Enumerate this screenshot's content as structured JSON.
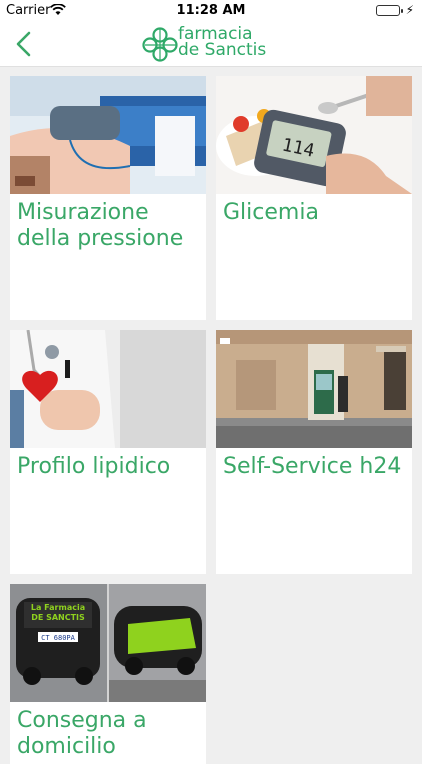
{
  "status_bar": {
    "carrier": "Carrier",
    "time": "11:28 AM"
  },
  "header": {
    "logo_line1": "farmacia",
    "logo_line2": "de Sanctis"
  },
  "services": [
    {
      "title": "Misurazione della pressione"
    },
    {
      "title": "Glicemia"
    },
    {
      "title": "Profilo lipidico"
    },
    {
      "title": "Self-Service h24"
    },
    {
      "title": "Consegna a domicilio"
    }
  ],
  "photo_labels": {
    "glucometer_reading": "114",
    "car_banner_line1": "La Farmacia",
    "car_banner_line2": "DE SANCTIS",
    "car_plate": "CT 680PA"
  },
  "colors": {
    "brand_green": "#3aa767",
    "background": "#efefef"
  }
}
